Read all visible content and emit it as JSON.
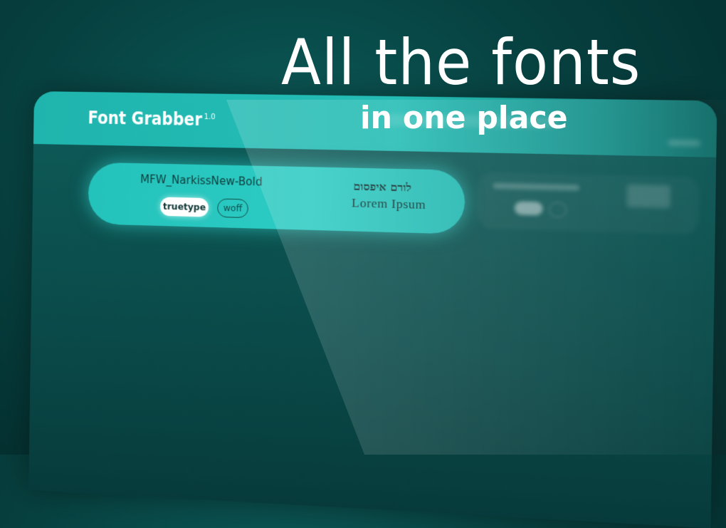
{
  "headline": {
    "line1": "All the fonts",
    "line2": "in one place"
  },
  "app": {
    "name": "Font Grabber",
    "version": "1.0"
  },
  "font_card": {
    "font_name": "MFW_NarkissNew-Bold",
    "formats": [
      "truetype",
      "woff"
    ],
    "selected_format": "truetype",
    "preview_hebrew": "לורם איפסום",
    "preview_latin": "Lorem Ipsum"
  },
  "colors": {
    "accent": "#24bdb5",
    "background": "#06403f",
    "badge_selected": "#ffffff"
  }
}
